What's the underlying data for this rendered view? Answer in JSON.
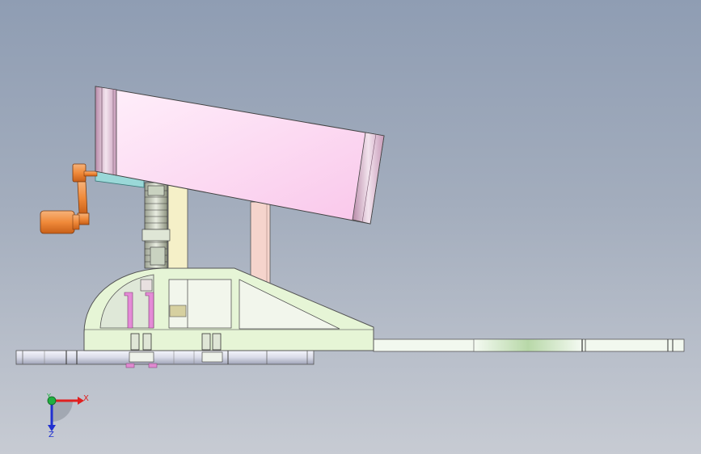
{
  "viewport": {
    "background_top": "#8f9db3",
    "background_bottom": "#c7cbd3"
  },
  "triad": {
    "x_label": "X",
    "y_label": "Y",
    "z_label": "Z",
    "x_color": "#e02020",
    "y_color": "#20b040",
    "z_color": "#2030d0"
  },
  "model": {
    "parts": [
      {
        "name": "tilted-barrel",
        "color": "#fdd3f0"
      },
      {
        "name": "hand-crank",
        "color": "#f08a3a"
      },
      {
        "name": "gear-stack",
        "color": "#d0d8c8"
      },
      {
        "name": "front-support-post",
        "color": "#f5f0c8"
      },
      {
        "name": "rear-support-post",
        "color": "#f5d0c8"
      },
      {
        "name": "frame-body",
        "color": "#e6f5d6"
      },
      {
        "name": "base-disc",
        "color": "#e6e8f2"
      },
      {
        "name": "slide-rail",
        "color": "#eaf4e8"
      }
    ]
  }
}
